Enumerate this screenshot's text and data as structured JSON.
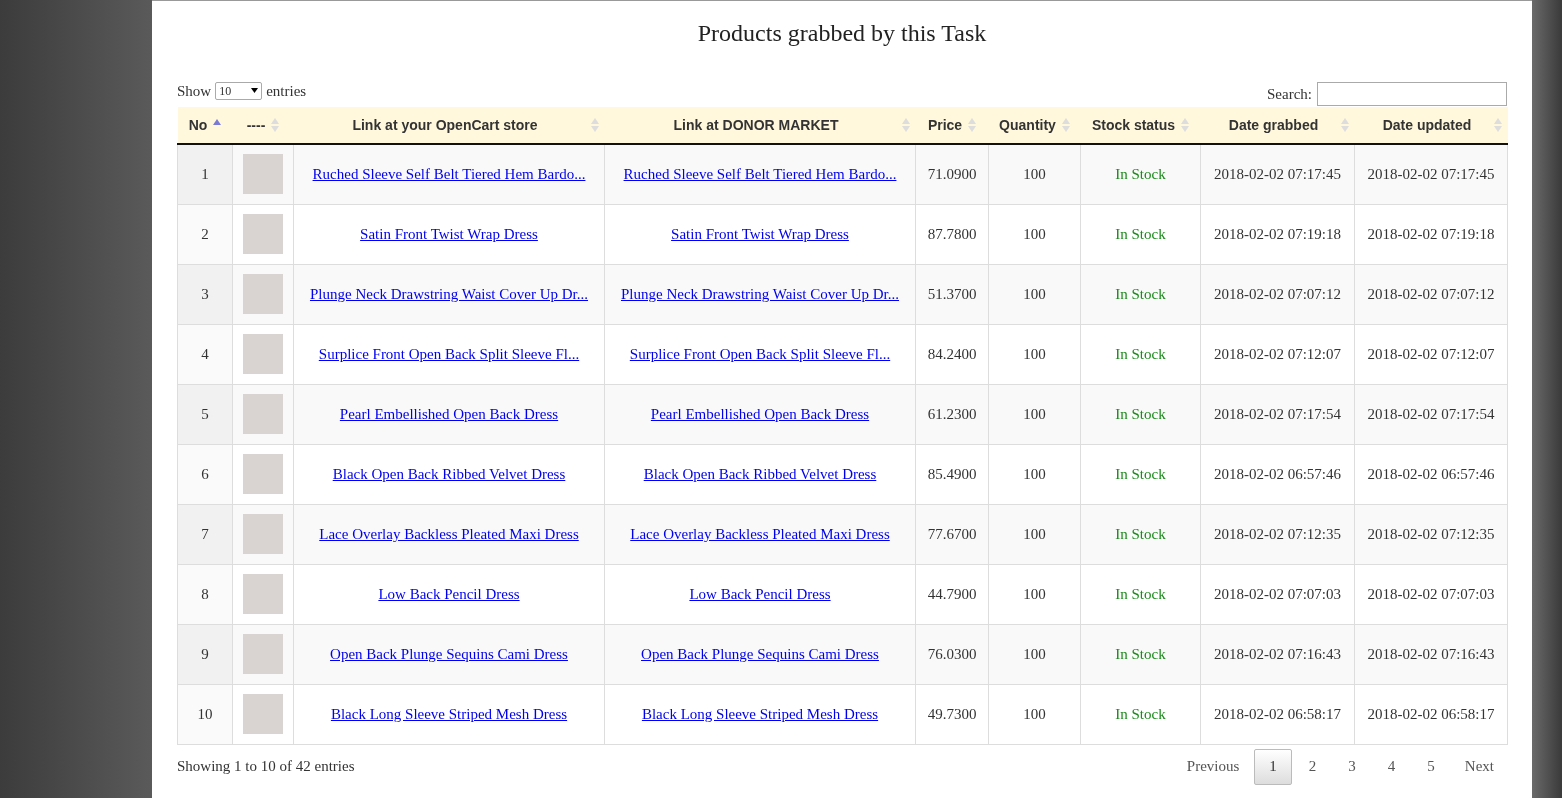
{
  "title": "Products grabbed by this Task",
  "length_menu": {
    "before": "Show",
    "value": "10",
    "after": "entries"
  },
  "search": {
    "label": "Search:"
  },
  "table": {
    "columns": [
      {
        "label": "No",
        "sorted": true
      },
      {
        "label": "----",
        "sorted": false
      },
      {
        "label": "Link at your OpenCart store",
        "sorted": false
      },
      {
        "label": "Link at DONOR MARKET",
        "sorted": false
      },
      {
        "label": "Price",
        "sorted": false
      },
      {
        "label": "Quantity",
        "sorted": false
      },
      {
        "label": "Stock status",
        "sorted": false
      },
      {
        "label": "Date grabbed",
        "sorted": false
      },
      {
        "label": "Date updated",
        "sorted": false
      }
    ],
    "rows": [
      {
        "no": "1",
        "store_link": "Ruched Sleeve Self Belt Tiered Hem Bardo...",
        "donor_link": "Ruched Sleeve Self Belt Tiered Hem Bardo...",
        "price": "71.0900",
        "quantity": "100",
        "stock": "In Stock",
        "date_grabbed": "2018-02-02 07:17:45",
        "date_updated": "2018-02-02 07:17:45"
      },
      {
        "no": "2",
        "store_link": "Satin Front Twist Wrap Dress",
        "donor_link": "Satin Front Twist Wrap Dress",
        "price": "87.7800",
        "quantity": "100",
        "stock": "In Stock",
        "date_grabbed": "2018-02-02 07:19:18",
        "date_updated": "2018-02-02 07:19:18"
      },
      {
        "no": "3",
        "store_link": "Plunge Neck Drawstring Waist Cover Up Dr...",
        "donor_link": "Plunge Neck Drawstring Waist Cover Up Dr...",
        "price": "51.3700",
        "quantity": "100",
        "stock": "In Stock",
        "date_grabbed": "2018-02-02 07:07:12",
        "date_updated": "2018-02-02 07:07:12"
      },
      {
        "no": "4",
        "store_link": "Surplice Front Open Back Split Sleeve Fl...",
        "donor_link": "Surplice Front Open Back Split Sleeve Fl...",
        "price": "84.2400",
        "quantity": "100",
        "stock": "In Stock",
        "date_grabbed": "2018-02-02 07:12:07",
        "date_updated": "2018-02-02 07:12:07"
      },
      {
        "no": "5",
        "store_link": "Pearl Embellished Open Back Dress",
        "donor_link": "Pearl Embellished Open Back Dress",
        "price": "61.2300",
        "quantity": "100",
        "stock": "In Stock",
        "date_grabbed": "2018-02-02 07:17:54",
        "date_updated": "2018-02-02 07:17:54"
      },
      {
        "no": "6",
        "store_link": "Black Open Back Ribbed Velvet Dress",
        "donor_link": "Black Open Back Ribbed Velvet Dress",
        "price": "85.4900",
        "quantity": "100",
        "stock": "In Stock",
        "date_grabbed": "2018-02-02 06:57:46",
        "date_updated": "2018-02-02 06:57:46"
      },
      {
        "no": "7",
        "store_link": "Lace Overlay Backless Pleated Maxi Dress",
        "donor_link": "Lace Overlay Backless Pleated Maxi Dress",
        "price": "77.6700",
        "quantity": "100",
        "stock": "In Stock",
        "date_grabbed": "2018-02-02 07:12:35",
        "date_updated": "2018-02-02 07:12:35"
      },
      {
        "no": "8",
        "store_link": "Low Back Pencil Dress",
        "donor_link": "Low Back Pencil Dress",
        "price": "44.7900",
        "quantity": "100",
        "stock": "In Stock",
        "date_grabbed": "2018-02-02 07:07:03",
        "date_updated": "2018-02-02 07:07:03"
      },
      {
        "no": "9",
        "store_link": "Open Back Plunge Sequins Cami Dress",
        "donor_link": "Open Back Plunge Sequins Cami Dress",
        "price": "76.0300",
        "quantity": "100",
        "stock": "In Stock",
        "date_grabbed": "2018-02-02 07:16:43",
        "date_updated": "2018-02-02 07:16:43"
      },
      {
        "no": "10",
        "store_link": "Black Long Sleeve Striped Mesh Dress",
        "donor_link": "Black Long Sleeve Striped Mesh Dress",
        "price": "49.7300",
        "quantity": "100",
        "stock": "In Stock",
        "date_grabbed": "2018-02-02 06:58:17",
        "date_updated": "2018-02-02 06:58:17"
      }
    ]
  },
  "info": "Showing 1 to 10 of 42 entries",
  "pagination": [
    {
      "label": "Previous",
      "kind": "nav",
      "selected": false
    },
    {
      "label": "1",
      "kind": "page",
      "selected": true
    },
    {
      "label": "2",
      "kind": "page",
      "selected": false
    },
    {
      "label": "3",
      "kind": "page",
      "selected": false
    },
    {
      "label": "4",
      "kind": "page",
      "selected": false
    },
    {
      "label": "5",
      "kind": "page",
      "selected": false
    },
    {
      "label": "Next",
      "kind": "nav",
      "selected": false
    }
  ]
}
